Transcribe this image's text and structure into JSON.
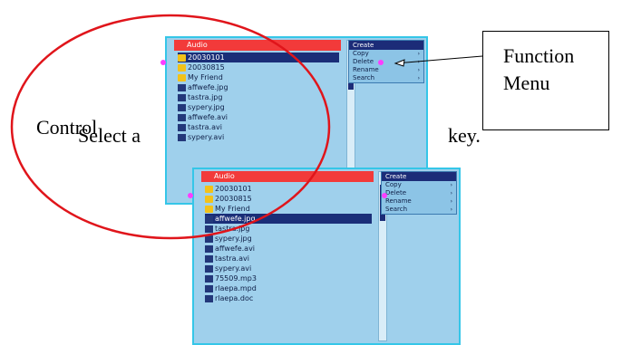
{
  "callout": {
    "text": "Function Menu"
  },
  "overlay": {
    "control_label": "Control",
    "select_text": "Select a",
    "key_text": "key."
  },
  "colors": {
    "ellipse": "#e0151b",
    "screen_border": "#35c6e8",
    "selection": "#1a2e78",
    "title_bar": "#f23a3a"
  },
  "screen1": {
    "title": "Audio",
    "files": [
      {
        "icon": "folder-icon",
        "name": "20030101",
        "selected": true
      },
      {
        "icon": "folder-icon",
        "name": "20030815",
        "selected": false
      },
      {
        "icon": "folder-icon",
        "name": "My Friend",
        "selected": false
      },
      {
        "icon": "file-icon",
        "name": "affwefe.jpg",
        "selected": false
      },
      {
        "icon": "file-icon",
        "name": "tastra.jpg",
        "selected": false
      },
      {
        "icon": "file-icon",
        "name": "sypery.jpg",
        "selected": false
      },
      {
        "icon": "file-icon",
        "name": "affwefe.avi",
        "selected": false
      },
      {
        "icon": "file-icon",
        "name": "tastra.avi",
        "selected": false
      },
      {
        "icon": "file-icon",
        "name": "sypery.avi",
        "selected": false
      }
    ],
    "menu": {
      "title": "Create",
      "items": [
        "Copy",
        "Delete",
        "Rename",
        "Search"
      ]
    }
  },
  "screen2": {
    "title": "Audio",
    "files": [
      {
        "icon": "folder-icon",
        "name": "20030101",
        "selected": false
      },
      {
        "icon": "folder-icon",
        "name": "20030815",
        "selected": false
      },
      {
        "icon": "folder-icon",
        "name": "My Friend",
        "selected": false
      },
      {
        "icon": "file-icon",
        "name": "affwefe.jpg",
        "selected": true
      },
      {
        "icon": "file-icon",
        "name": "tastra.jpg",
        "selected": false
      },
      {
        "icon": "file-icon",
        "name": "sypery.jpg",
        "selected": false
      },
      {
        "icon": "file-icon",
        "name": "affwefe.avi",
        "selected": false
      },
      {
        "icon": "file-icon",
        "name": "tastra.avi",
        "selected": false
      },
      {
        "icon": "file-icon",
        "name": "sypery.avi",
        "selected": false
      },
      {
        "icon": "music-icon",
        "name": "75509.mp3",
        "selected": false
      },
      {
        "icon": "file-icon",
        "name": "rlaepa.mpd",
        "selected": false
      },
      {
        "icon": "file-icon",
        "name": "rlaepa.doc",
        "selected": false
      }
    ],
    "menu": {
      "title": "Create",
      "items": [
        "Copy",
        "Delete",
        "Rename",
        "Search"
      ]
    }
  }
}
